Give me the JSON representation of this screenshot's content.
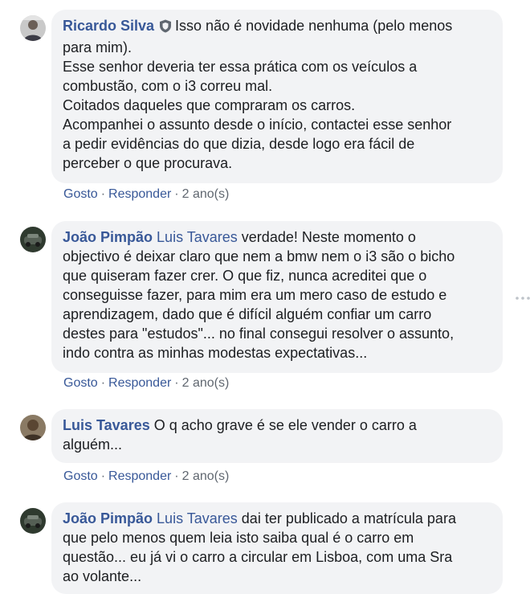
{
  "comments": [
    {
      "author": "Ricardo Silva",
      "mention": "",
      "text_lines": [
        "Isso não é novidade nenhuma (pelo menos",
        "para mim).",
        "Esse senhor deveria ter essa prática com os veículos a",
        "combustão, com o i3 correu mal.",
        "Coitados daqueles que compraram os carros.",
        "Acompanhei o assunto desde o início, contactei esse senhor",
        "a pedir evidências do que dizia, desde logo era fácil de",
        "perceber o que procurava."
      ],
      "like_label": "Gosto",
      "reply_label": "Responder",
      "time": "2 ano(s)"
    },
    {
      "author": "João Pimpão",
      "mention": "Luis Tavares",
      "text_lines": [
        "verdade! Neste momento o",
        "objectivo é deixar claro que nem a bmw nem o i3 são o bicho",
        "que quiseram fazer crer. O que fiz, nunca acreditei que o",
        "conseguisse fazer, para mim era um mero caso de estudo e",
        "aprendizagem, dado que é difícil alguém confiar um carro",
        "destes para \"estudos\"... no final consegui resolver o assunto,",
        "indo contra as minhas modestas expectativas..."
      ],
      "like_label": "Gosto",
      "reply_label": "Responder",
      "time": "2 ano(s)"
    },
    {
      "author": "Luis Tavares",
      "mention": "",
      "text_lines": [
        "O q acho grave é se ele vender o carro a",
        "alguém..."
      ],
      "like_label": "Gosto",
      "reply_label": "Responder",
      "time": "2 ano(s)"
    },
    {
      "author": "João Pimpão",
      "mention": "Luis Tavares",
      "text_lines": [
        "dai ter publicado a matrícula para",
        "que pelo menos quem leia isto saiba qual é o carro em",
        "questão... eu já vi o carro a circular em Lisboa, com uma Sra",
        "ao volante..."
      ]
    }
  ],
  "separator": "·",
  "icons": {
    "verified": "shield-icon",
    "more": "more-options-icon"
  },
  "colors": {
    "author": "#385898",
    "bubble": "#f2f3f5",
    "meta": "#606770",
    "text": "#1c1e21"
  }
}
